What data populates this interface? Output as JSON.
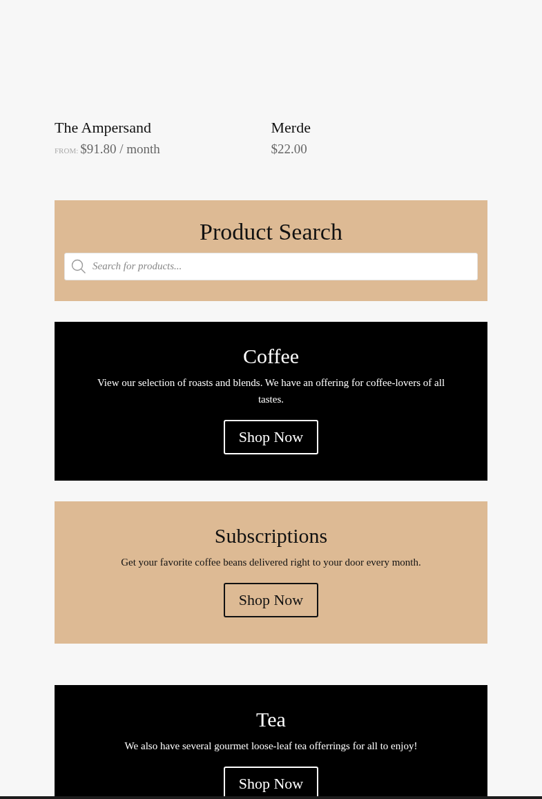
{
  "products": [
    {
      "name": "The Ampersand",
      "price_prefix": "FROM:",
      "price": "$91.80 / month"
    },
    {
      "name": "Merde",
      "price": "$22.00"
    }
  ],
  "sections": [
    {
      "kind": "search",
      "color": "#ddba94",
      "title": "Product Search",
      "placeholder": "Search for products..."
    },
    {
      "kind": "promo",
      "color": "#000000",
      "title": "Coffee",
      "text": "View our selection of roasts and blends.  We have an offering for coffee-lovers of all tastes.",
      "button": "Shop Now"
    },
    {
      "kind": "promo",
      "color": "#ddba94",
      "title": "Subscriptions",
      "text": "Get your favorite coffee beans delivered right to your door every month.",
      "button": "Shop Now"
    },
    {
      "kind": "promo",
      "color": "#000000",
      "title": "Tea",
      "text": "We also have several gourmet loose-leaf tea offerrings for all to enjoy!",
      "button": "Shop Now"
    }
  ]
}
